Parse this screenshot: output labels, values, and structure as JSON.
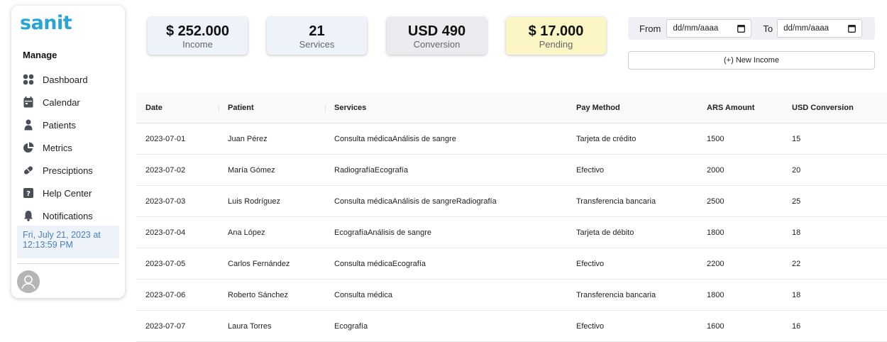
{
  "brand": {
    "logo": "sanit"
  },
  "sidebar": {
    "section_title": "Manage",
    "items": [
      {
        "label": "Dashboard",
        "icon": "grid-icon"
      },
      {
        "label": "Calendar",
        "icon": "calendar-icon"
      },
      {
        "label": "Patients",
        "icon": "person-icon"
      },
      {
        "label": "Metrics",
        "icon": "pie-chart-icon"
      },
      {
        "label": "Presciptions",
        "icon": "pill-icon"
      },
      {
        "label": "Help Center",
        "icon": "question-icon"
      },
      {
        "label": "Notifications",
        "icon": "bell-icon"
      }
    ],
    "datetime": "Fri, July 21, 2023 at 12:13:59 PM"
  },
  "stats": [
    {
      "value": "$ 252.000",
      "label": "Income",
      "bg": "#eef2f9"
    },
    {
      "value": "21",
      "label": "Services",
      "bg": "#eef2f9"
    },
    {
      "value": "USD 490",
      "label": "Conversion",
      "bg": "#ececf0"
    },
    {
      "value": "$ 17.000",
      "label": "Pending",
      "bg": "#fbf6c4"
    }
  ],
  "filters": {
    "from_label": "From",
    "to_label": "To",
    "from_placeholder": "dd/mm/aaaa",
    "to_placeholder": "dd/mm/aaaa",
    "new_income_label": "(+) New Income"
  },
  "table": {
    "columns": [
      "Date",
      "Patient",
      "Services",
      "Pay Method",
      "ARS Amount",
      "USD Conversion"
    ],
    "rows": [
      [
        "2023-07-01",
        "Juan Pérez",
        "Consulta médicaAnálisis de sangre",
        "Tarjeta de crédito",
        "1500",
        "15"
      ],
      [
        "2023-07-02",
        "María Gómez",
        "RadiografíaEcografía",
        "Efectivo",
        "2000",
        "20"
      ],
      [
        "2023-07-03",
        "Luis Rodríguez",
        "Consulta médicaAnálisis de sangreRadiografía",
        "Transferencia bancaria",
        "2500",
        "25"
      ],
      [
        "2023-07-04",
        "Ana López",
        "EcografíaAnálisis de sangre",
        "Tarjeta de débito",
        "1800",
        "18"
      ],
      [
        "2023-07-05",
        "Carlos Fernández",
        "Consulta médicaEcografía",
        "Efectivo",
        "2200",
        "22"
      ],
      [
        "2023-07-06",
        "Roberto Sánchez",
        "Consulta médica",
        "Transferencia bancaria",
        "1800",
        "18"
      ],
      [
        "2023-07-07",
        "Laura Torres",
        "Ecografía",
        "Efectivo",
        "1600",
        "16"
      ]
    ]
  }
}
